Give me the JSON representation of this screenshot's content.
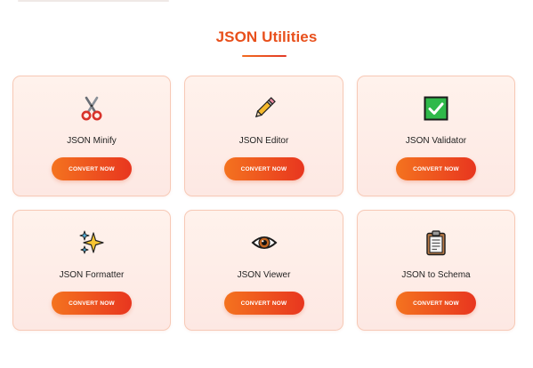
{
  "section": {
    "title": "JSON Utilities"
  },
  "tools": [
    {
      "name": "JSON Minify",
      "button_label": "CONVERT NOW",
      "icon": "scissors-icon"
    },
    {
      "name": "JSON Editor",
      "button_label": "CONVERT NOW",
      "icon": "pencil-icon"
    },
    {
      "name": "JSON Validator",
      "button_label": "CONVERT NOW",
      "icon": "check-box-icon"
    },
    {
      "name": "JSON Formatter",
      "button_label": "CONVERT NOW",
      "icon": "sparkles-icon"
    },
    {
      "name": "JSON Viewer",
      "button_label": "CONVERT NOW",
      "icon": "eye-icon"
    },
    {
      "name": "JSON to Schema",
      "button_label": "CONVERT NOW",
      "icon": "clipboard-icon"
    }
  ],
  "colors": {
    "accent": "#e8501c",
    "button_start": "#f4731f",
    "button_end": "#e8361f",
    "card_border": "#f7c9b6",
    "card_bg": "#fff2ec",
    "check_green": "#2fb94a"
  }
}
